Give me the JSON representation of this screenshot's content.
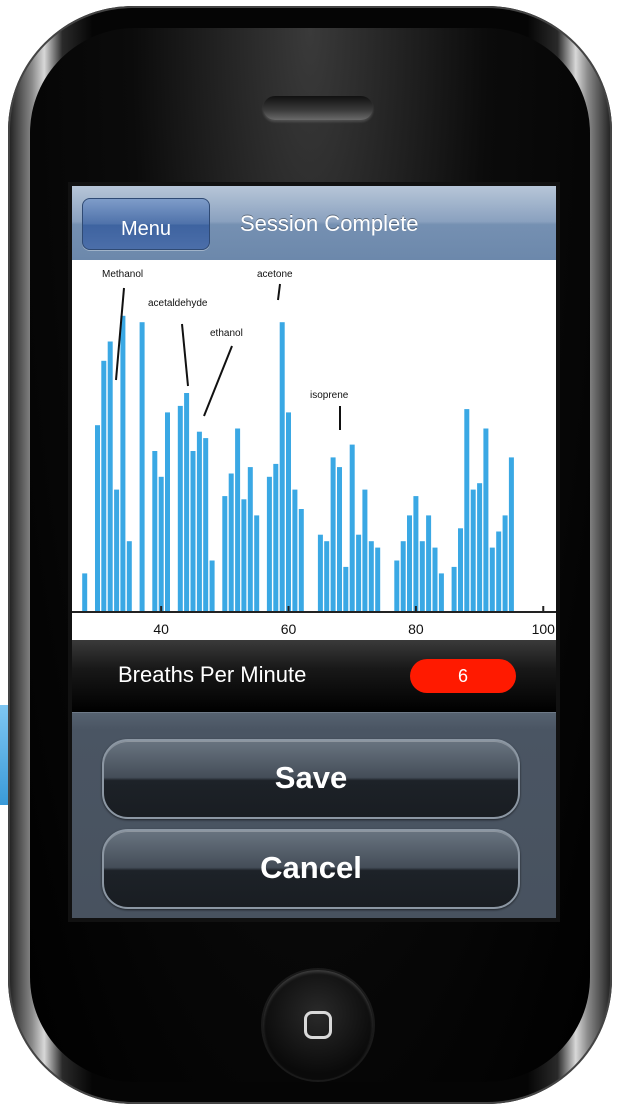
{
  "navbar": {
    "menu_label": "Menu",
    "title": "Session Complete"
  },
  "chart_data": {
    "type": "bar",
    "x_ticks": [
      "40",
      "60",
      "80",
      "100"
    ],
    "xlim": [
      26,
      102
    ],
    "annotations": [
      "Methanol",
      "acetaldehyde",
      "ethanol",
      "acetone",
      "isoprene"
    ],
    "bar_color": "#3aa8e4",
    "x": [
      28,
      30,
      31,
      32,
      33,
      34,
      35,
      37,
      39,
      40,
      41,
      43,
      44,
      45,
      46,
      47,
      48,
      50,
      51,
      52,
      53,
      54,
      55,
      57,
      58,
      59,
      60,
      61,
      62,
      65,
      66,
      67,
      68,
      69,
      70,
      71,
      72,
      73,
      74,
      77,
      78,
      79,
      80,
      81,
      82,
      83,
      84,
      86,
      87,
      88,
      89,
      90,
      91,
      92,
      93,
      94,
      95
    ],
    "values": [
      12,
      58,
      78,
      84,
      38,
      92,
      22,
      90,
      50,
      42,
      62,
      64,
      68,
      50,
      56,
      54,
      16,
      36,
      43,
      57,
      35,
      45,
      30,
      42,
      46,
      90,
      62,
      38,
      32,
      24,
      22,
      48,
      45,
      14,
      52,
      24,
      38,
      22,
      20,
      16,
      22,
      30,
      36,
      22,
      30,
      20,
      12,
      14,
      26,
      63,
      38,
      40,
      57,
      20,
      25,
      30,
      48
    ]
  },
  "status": {
    "label": "Breaths Per Minute",
    "value": "6",
    "value_color": "#ff1a00"
  },
  "actions": {
    "save_label": "Save",
    "cancel_label": "Cancel"
  }
}
